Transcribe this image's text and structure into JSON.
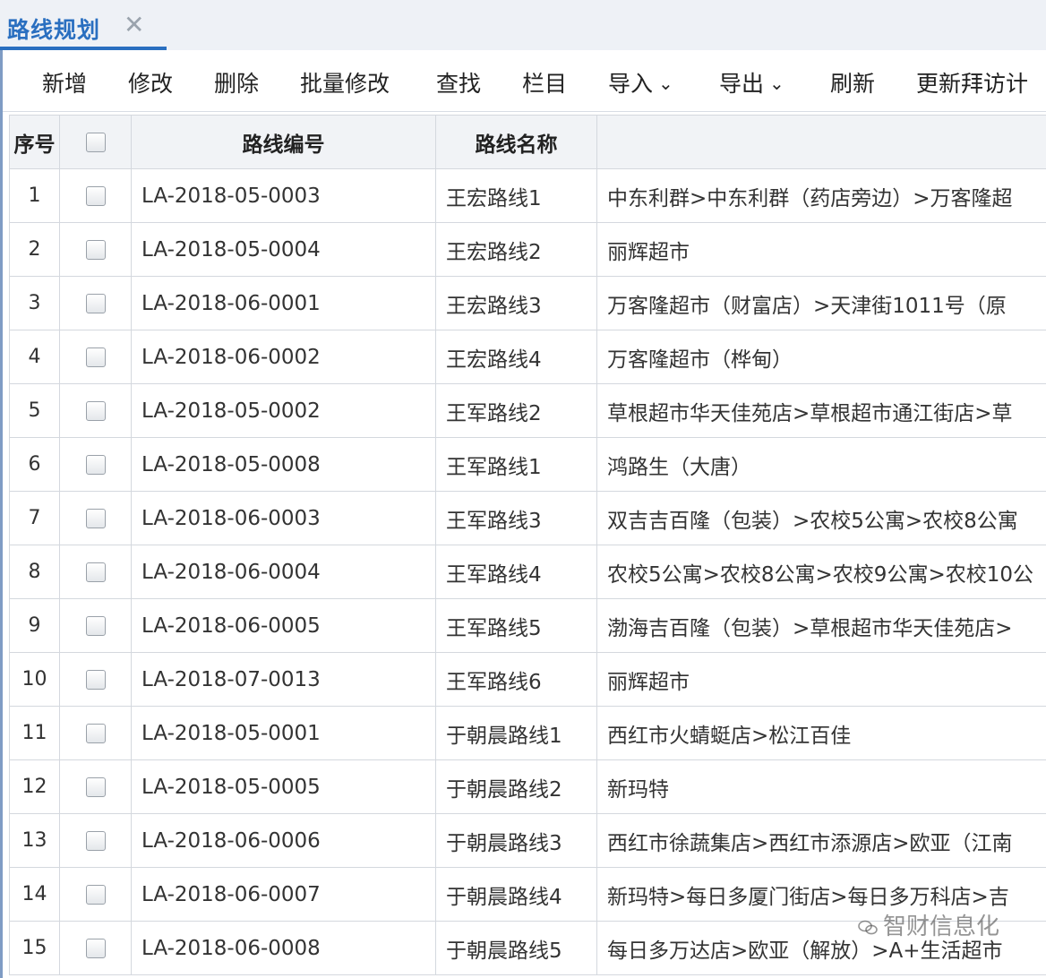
{
  "tab": {
    "title": "路线规划",
    "close_glyph": "✕"
  },
  "toolbar": {
    "add": "新增",
    "edit": "修改",
    "delete": "删除",
    "batch_edit": "批量修改",
    "find": "查找",
    "columns": "栏目",
    "import": "导入",
    "export": "导出",
    "refresh": "刷新",
    "update_visit": "更新拜访计"
  },
  "table": {
    "headers": {
      "index": "序号",
      "route_code": "路线编号",
      "route_name": "路线名称",
      "route_detail": ""
    },
    "rows": [
      {
        "no": "1",
        "code": "LA-2018-05-0003",
        "name": "王宏路线1",
        "detail": "中东利群>中东利群（药店旁边）>万客隆超"
      },
      {
        "no": "2",
        "code": "LA-2018-05-0004",
        "name": "王宏路线2",
        "detail": "丽辉超市"
      },
      {
        "no": "3",
        "code": "LA-2018-06-0001",
        "name": "王宏路线3",
        "detail": "万客隆超市（财富店）>天津街1011号（原"
      },
      {
        "no": "4",
        "code": "LA-2018-06-0002",
        "name": "王宏路线4",
        "detail": "万客隆超市（桦甸）"
      },
      {
        "no": "5",
        "code": "LA-2018-05-0002",
        "name": "王军路线2",
        "detail": "草根超市华天佳苑店>草根超市通江街店>草"
      },
      {
        "no": "6",
        "code": "LA-2018-05-0008",
        "name": "王军路线1",
        "detail": "鸿路生（大唐）"
      },
      {
        "no": "7",
        "code": "LA-2018-06-0003",
        "name": "王军路线3",
        "detail": "双吉吉百隆（包装）>农校5公寓>农校8公寓"
      },
      {
        "no": "8",
        "code": "LA-2018-06-0004",
        "name": "王军路线4",
        "detail": "农校5公寓>农校8公寓>农校9公寓>农校10公"
      },
      {
        "no": "9",
        "code": "LA-2018-06-0005",
        "name": "王军路线5",
        "detail": "渤海吉百隆（包装）>草根超市华天佳苑店>"
      },
      {
        "no": "10",
        "code": "LA-2018-07-0013",
        "name": "王军路线6",
        "detail": "丽辉超市"
      },
      {
        "no": "11",
        "code": "LA-2018-05-0001",
        "name": "于朝晨路线1",
        "detail": "西红市火蜻蜓店>松江百佳"
      },
      {
        "no": "12",
        "code": "LA-2018-05-0005",
        "name": "于朝晨路线2",
        "detail": "新玛特"
      },
      {
        "no": "13",
        "code": "LA-2018-06-0006",
        "name": "于朝晨路线3",
        "detail": "西红市徐蔬集店>西红市添源店>欧亚（江南"
      },
      {
        "no": "14",
        "code": "LA-2018-06-0007",
        "name": "于朝晨路线4",
        "detail": "新玛特>每日多厦门街店>每日多万科店>吉"
      },
      {
        "no": "15",
        "code": "LA-2018-06-0008",
        "name": "于朝晨路线5",
        "detail": "每日多万达店>欧亚（解放）>A+生活超市"
      }
    ]
  },
  "watermark": {
    "text": "智财信息化"
  },
  "colors": {
    "accent": "#2a6fc0",
    "header_bg": "#f1f3f6",
    "border": "#d4d8de"
  }
}
